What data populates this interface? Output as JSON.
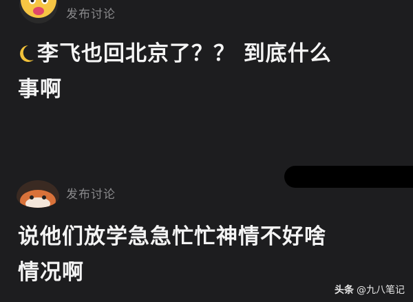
{
  "post1": {
    "tag": "发布讨论",
    "text_main": "李飞也回北京了？？ 到底什么",
    "text_line2": "事啊",
    "leading_icon": "crescent-moon-emoji"
  },
  "post2": {
    "tag": "发布讨论",
    "text_line1": "说他们放学急急忙忙神情不好啥",
    "text_line2": "情况啊"
  },
  "watermark": {
    "brand": "头条",
    "handle": "@九八笔记"
  },
  "colors": {
    "background": "#1d1d1f",
    "tag": "#8a8a8c",
    "text": "#f4f4f4"
  }
}
